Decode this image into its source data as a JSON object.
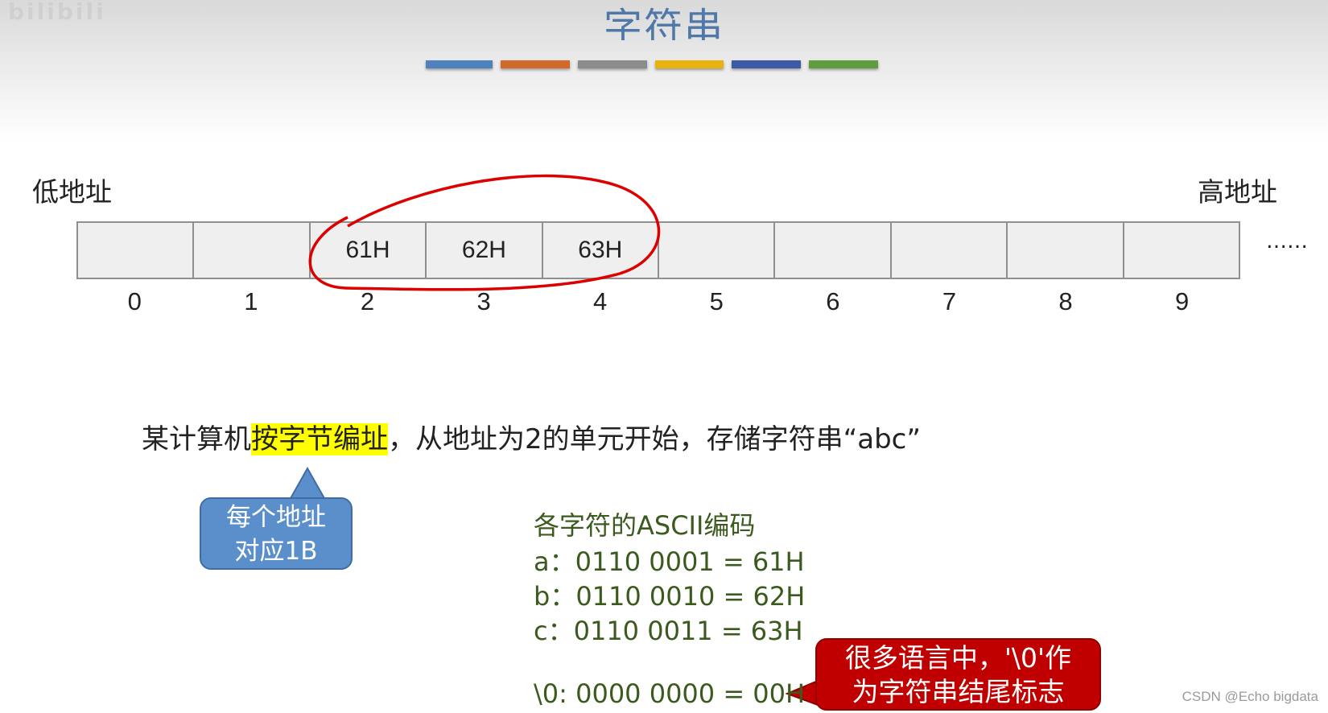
{
  "watermark_top_left": "bilibili",
  "title": "字符串",
  "decor_colors": [
    "#4f81bd",
    "#d0692a",
    "#8c8c8c",
    "#e8b311",
    "#3d5aa8",
    "#5f9e3e"
  ],
  "low_address_label": "低地址",
  "high_address_label": "高地址",
  "memory_cells": [
    "",
    "",
    "61H",
    "62H",
    "63H",
    "",
    "",
    "",
    "",
    ""
  ],
  "addresses": [
    "0",
    "1",
    "2",
    "3",
    "4",
    "5",
    "6",
    "7",
    "8",
    "9"
  ],
  "ellipsis": "……",
  "sentence": {
    "before": "某计算机",
    "highlight": "按字节编址",
    "after": "，从地址为2的单元开始，存储字符串“abc”",
    "highlight_color": "#ffff00"
  },
  "blue_callout": {
    "line1": "每个地址",
    "line2": "对应1B",
    "color": "#5b8fcc"
  },
  "ascii": {
    "heading": "各字符的ASCII编码",
    "a": "a：0110 0001 = 61H",
    "b": "b：0110 0010 = 62H",
    "c": "c：0110 0011 = 63H",
    "nul": "\\0: 0000 0000 = 00H",
    "color": "#3b5a1d"
  },
  "red_callout": {
    "line1": "很多语言中，'\\0'作",
    "line2": "为字符串结尾标志",
    "color": "#c00000"
  },
  "annotation_color": "#dd0000",
  "footer_watermark": "CSDN @Echo bigdata"
}
